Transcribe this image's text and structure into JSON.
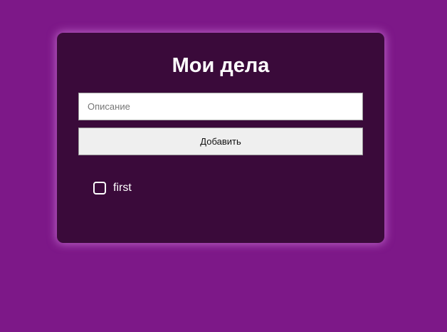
{
  "app": {
    "title": "Мои дела"
  },
  "form": {
    "description_placeholder": "Описание",
    "description_value": "",
    "add_label": "Добавить"
  },
  "todos": [
    {
      "text": "first",
      "done": false
    }
  ],
  "colors": {
    "page_background": "#7d1888",
    "card_background": "#3a0a3a",
    "text": "#ffffff"
  }
}
